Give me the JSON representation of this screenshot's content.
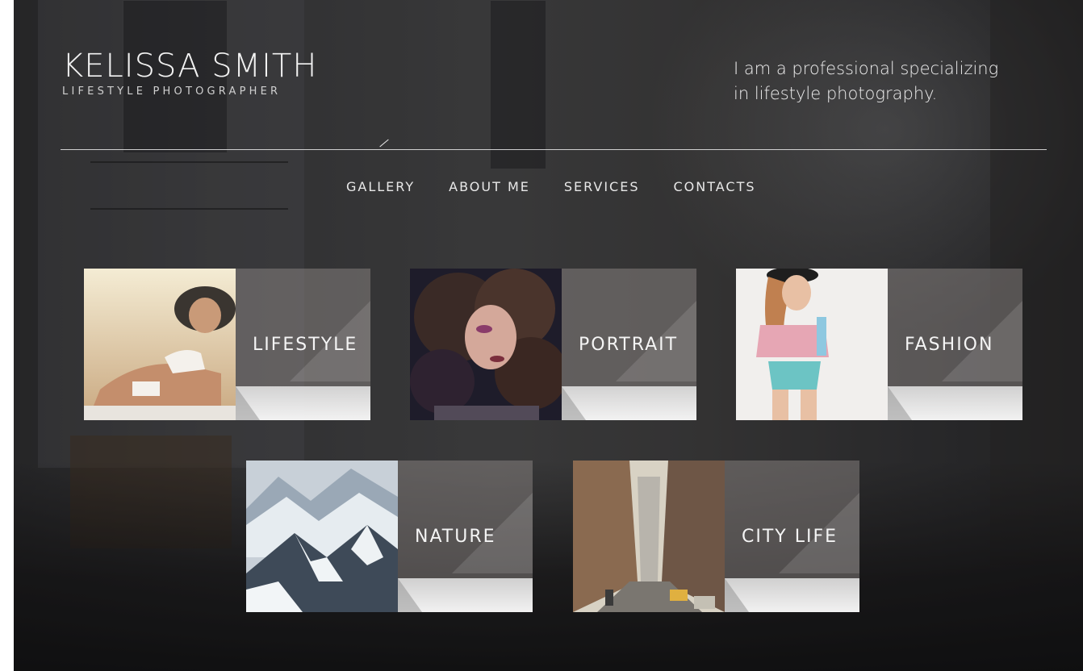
{
  "brand": {
    "name": "KELISSA SMITH",
    "subtitle": "LIFESTYLE PHOTOGRAPHER"
  },
  "tagline": {
    "line1": "I am a professional specializing",
    "line2": "in lifestyle photography."
  },
  "nav": {
    "items": [
      {
        "label": "GALLERY"
      },
      {
        "label": "ABOUT ME"
      },
      {
        "label": "SERVICES"
      },
      {
        "label": "CONTACTS"
      }
    ]
  },
  "gallery": {
    "cards": [
      {
        "label": "LIFESTYLE",
        "photo": "woman-sunbathing-photo"
      },
      {
        "label": "PORTRAIT",
        "photo": "curly-hair-portrait-photo"
      },
      {
        "label": "FASHION",
        "photo": "fashion-model-photo"
      },
      {
        "label": "NATURE",
        "photo": "snowy-mountains-photo"
      },
      {
        "label": "CITY LIFE",
        "photo": "city-street-photo"
      }
    ]
  },
  "colors": {
    "text_primary": "#f2f2f2",
    "panel_tint": "#96918e",
    "page_margin": "#ffffff"
  }
}
